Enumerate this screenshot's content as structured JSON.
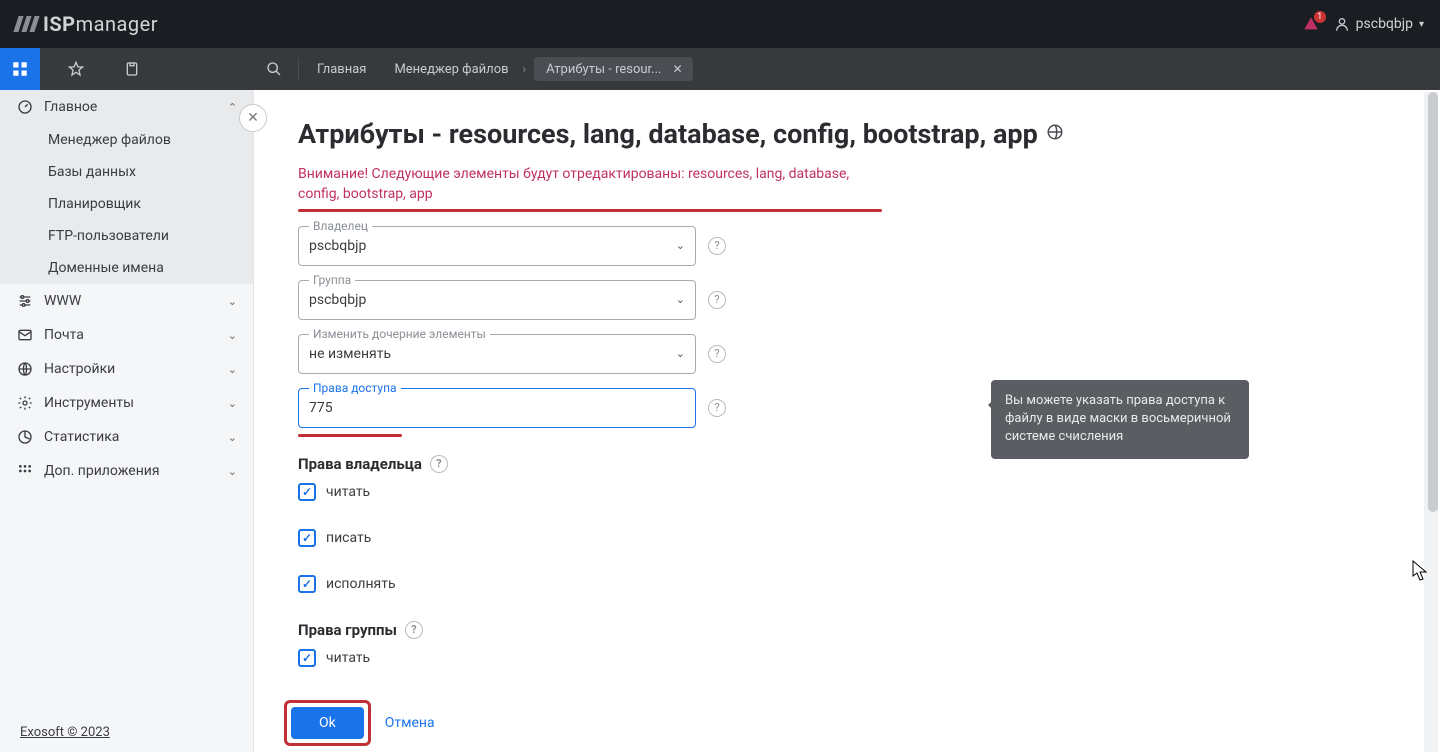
{
  "brand": {
    "isp": "ISP",
    "manager": "manager"
  },
  "topbar": {
    "username": "pscbqbjp",
    "notif_count": "1"
  },
  "secondbar": {
    "crumbs": [
      "Главная",
      "Менеджер файлов"
    ],
    "tab_label": "Атрибуты - resour..."
  },
  "sidebar": {
    "main": {
      "label": "Главное",
      "items": [
        "Менеджер файлов",
        "Базы данных",
        "Планировщик",
        "FTP-пользователи",
        "Доменные имена"
      ]
    },
    "sections": [
      "WWW",
      "Почта",
      "Настройки",
      "Инструменты",
      "Статистика",
      "Доп. приложения"
    ],
    "footer": "Exosoft © 2023"
  },
  "page": {
    "title": "Атрибуты - resources, lang, database, config, bootstrap, app",
    "warning": "Внимание! Следующие элементы будут отредактированы: resources, lang, database, config, bootstrap, app"
  },
  "form": {
    "owner": {
      "label": "Владелец",
      "value": "pscbqbjp"
    },
    "group": {
      "label": "Группа",
      "value": "pscbqbjp"
    },
    "children": {
      "label": "Изменить дочерние элементы",
      "value": "не изменять"
    },
    "perms": {
      "label": "Права доступа",
      "value": "775"
    },
    "owner_perms": {
      "title": "Права владельца",
      "read": "читать",
      "write": "писать",
      "exec": "исполнять"
    },
    "group_perms": {
      "title": "Права группы",
      "read": "читать"
    }
  },
  "tooltip": "Вы можете указать права доступа к файлу в виде маски в восьмеричной системе счисления",
  "actions": {
    "ok": "Ok",
    "cancel": "Отмена"
  }
}
